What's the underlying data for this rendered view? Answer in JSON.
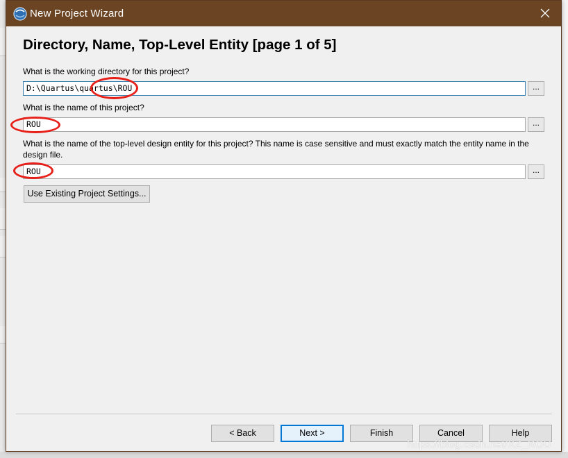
{
  "window": {
    "title": "New Project Wizard",
    "heading": "Directory, Name, Top-Level Entity [page 1 of 5]"
  },
  "fields": {
    "working_dir": {
      "label": "What is the working directory for this project?",
      "value": "D:\\Quartus\\quartus\\ROU"
    },
    "project_name": {
      "label": "What is the name of this project?",
      "value": "ROU"
    },
    "top_entity": {
      "label": "What is the name of the top-level design entity for this project? This name is case sensitive and must exactly match the entity name in the design file.",
      "value": "ROU"
    },
    "browse_label": "..."
  },
  "buttons": {
    "use_existing": "Use Existing Project Settings...",
    "back": "< Back",
    "next": "Next >",
    "finish": "Finish",
    "cancel": "Cancel",
    "help": "Help"
  },
  "watermark": "https://blog.csdn.net/XZ_ROU",
  "colors": {
    "titlebar": "#6b4423",
    "annotation": "#e8201a",
    "default_button_border": "#0078d7"
  },
  "icons": {
    "app": "quartus-app-icon",
    "close": "close-icon"
  }
}
